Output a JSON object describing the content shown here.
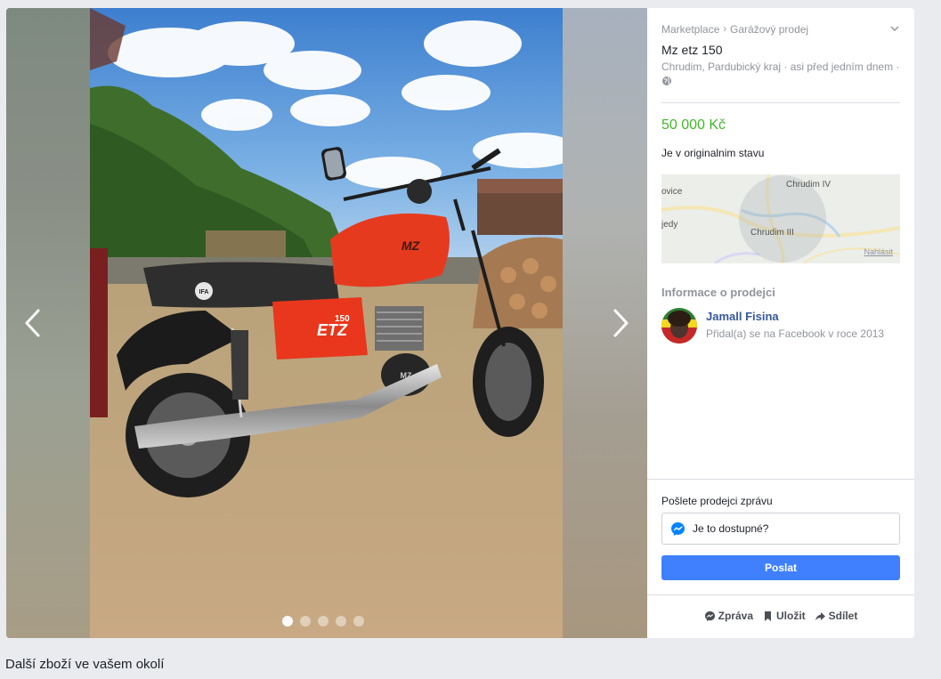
{
  "listing": {
    "breadcrumb": [
      "Marketplace",
      "Garážový prodej"
    ],
    "breadcrumb_separator": "›",
    "title": "Mz etz 150",
    "location": "Chrudim, Pardubický kraj · asi před jedním dnem ·",
    "price": "50 000 Kč",
    "description": "Je v originalnim stavu",
    "price_color": "#42b72a",
    "photo_logos": [
      "IFA",
      "MZ",
      "ETZ",
      "150"
    ]
  },
  "map": {
    "labels": [
      "Chrudim IV",
      "Chrudim III",
      "ovice",
      "jedy"
    ],
    "report_link": "Nahlásit"
  },
  "seller": {
    "heading": "Informace o prodejci",
    "name": "Jamall Fisina",
    "since": "Přidal(a) se na Facebook v roce 2013"
  },
  "message": {
    "heading": "Pošlete prodejci zprávu",
    "prefill": "Je to dostupné?",
    "send_label": "Poslat",
    "button_color": "#4080ff"
  },
  "actions": {
    "message_label": "Zpráva",
    "save_label": "Uložit",
    "share_label": "Sdílet"
  },
  "gallery": {
    "photo_count": 5,
    "active_photo_index": 0
  },
  "footer": {
    "nearby_heading": "Další zboží ve vašem okolí"
  },
  "icons": [
    "chevron-left-icon",
    "chevron-right-icon",
    "chevron-down-icon",
    "globe-icon",
    "messenger-icon",
    "save-bookmark-icon",
    "share-arrow-icon"
  ]
}
